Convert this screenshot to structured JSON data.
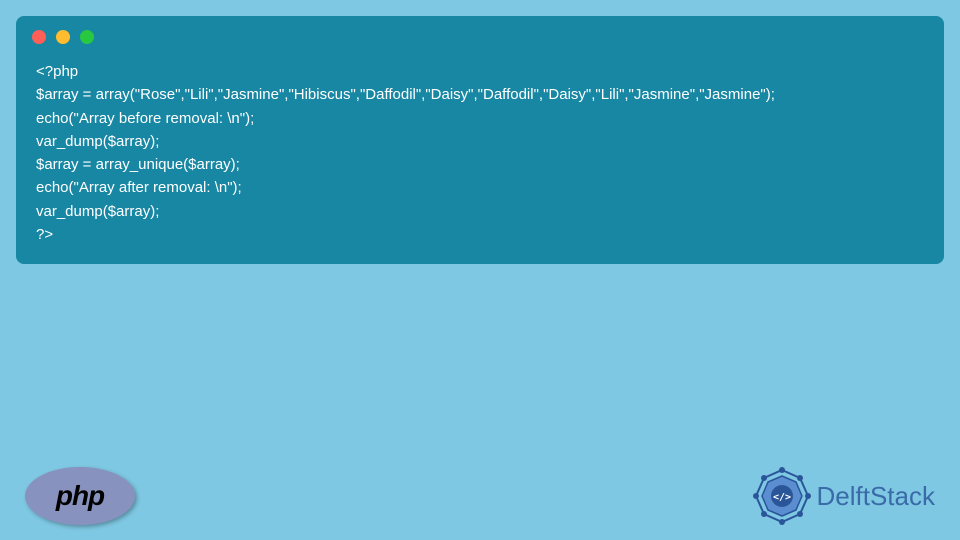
{
  "code": {
    "lines": [
      "<?php",
      "$array = array(\"Rose\",\"Lili\",\"Jasmine\",\"Hibiscus\",\"Daffodil\",\"Daisy\",\"Daffodil\",\"Daisy\",\"Lili\",\"Jasmine\",\"Jasmine\");",
      "echo(\"Array before removal: \\n\");",
      "var_dump($array);",
      "$array = array_unique($array);",
      "echo(\"Array after removal: \\n\");",
      "var_dump($array);",
      "?>"
    ]
  },
  "php_logo_text": "php",
  "delftstack_text": "DelftStack"
}
